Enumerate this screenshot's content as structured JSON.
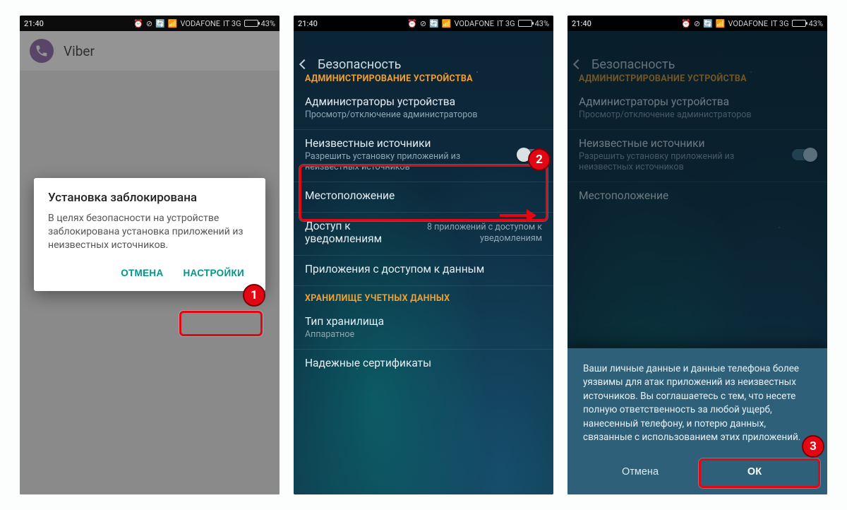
{
  "status": {
    "time": "21:40",
    "carrier": "VODAFONE",
    "network": "IT 3G",
    "battery_pct": "43%"
  },
  "phone1": {
    "app_title": "Viber",
    "dialog_title": "Установка заблокирована",
    "dialog_body": "В целях безопасности на устройстве заблокирована установка приложений из неизвестных источников.",
    "cancel": "ОТМЕНА",
    "settings": "НАСТРОЙКИ",
    "marker": "1"
  },
  "security": {
    "header": "Безопасность",
    "section_admin": "АДМИНИСТРИРОВАНИЕ УСТРОЙСТВА",
    "admins_title": "Администраторы устройства",
    "admins_sub": "Просмотр/отключение администраторов",
    "unknown_title": "Неизвестные источники",
    "unknown_sub": "Разрешить установку приложений из неизвестных источников",
    "location_title": "Местоположение",
    "notif_access_title": "Доступ к уведомлениям",
    "notif_access_sub": "8 приложений с доступом к уведомлениям",
    "apps_data_title": "Приложения с доступом к данным",
    "section_storage": "ХРАНИЛИЩЕ УЧЕТНЫХ ДАННЫХ",
    "storage_type_title": "Тип хранилища",
    "storage_type_sub": "Аппаратное",
    "trusted_certs": "Надежные сертификаты",
    "marker": "2"
  },
  "phone3": {
    "warning_body": "Ваши личные данные и данные телефона более уязвимы для атак приложений из неизвестных источников. Вы соглашаетесь с тем, что несете полную ответственность за любой ущерб, нанесенный телефону, и потерю данных, связанные с использованием этих приложений.",
    "cancel": "Отмена",
    "ok": "ОК",
    "marker": "3"
  }
}
